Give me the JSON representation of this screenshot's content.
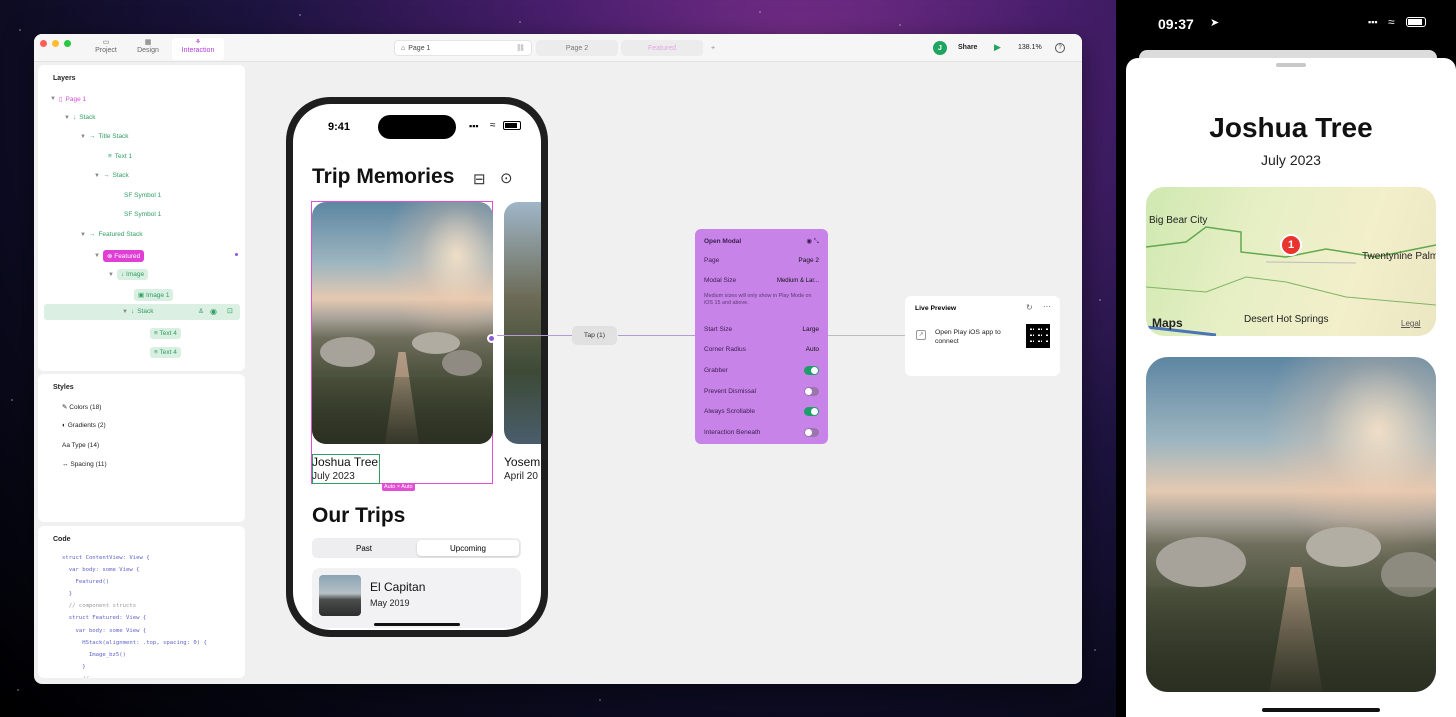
{
  "app": {
    "tabs": [
      {
        "label": "Project",
        "icon": "folder-icon"
      },
      {
        "label": "Design",
        "icon": "grid-icon"
      },
      {
        "label": "Interaction",
        "icon": "interaction-icon"
      }
    ],
    "page_tabs": [
      "Page 1",
      "Page 2",
      "Featured"
    ],
    "share_label": "Share",
    "avatar_initial": "J",
    "zoom": "138.1%",
    "accent": "#b23ed9"
  },
  "layers": {
    "title": "Layers",
    "items": [
      "Page 1",
      "Stack",
      "Title Stack",
      "Text 1",
      "Stack",
      "SF Symbol 1",
      "SF Symbol 1",
      "Featured Stack",
      "Featured",
      "Image",
      "Image 1",
      "Stack",
      "Text 4",
      "Text 4"
    ]
  },
  "styles": {
    "title": "Styles",
    "items": [
      "Colors (18)",
      "Gradients (2)",
      "Type (14)",
      "Spacing (11)"
    ]
  },
  "code": {
    "title": "Code",
    "lines": [
      "struct ContentView: View {",
      "  var body: some View {",
      "    Featured()",
      "  }",
      "  // component structs",
      "  struct Featured: View {",
      "    var body: some View {",
      "      HStack(alignment: .top, spacing: 0) {",
      "        Image_bz5()",
      "      }",
      "      // ..."
    ]
  },
  "phone": {
    "time": "9:41",
    "title": "Trip Memories",
    "card1_title": "Joshua Tree",
    "card1_date": "July 2023",
    "card2_title": "Yosem",
    "card2_date": "April 20",
    "size_badge": "Auto × Auto",
    "section_title": "Our Trips",
    "segments": [
      "Past",
      "Upcoming"
    ],
    "trip_title": "El Capitan",
    "trip_date": "May 2019"
  },
  "flow": {
    "tap_label": "Tap (1)",
    "modal": {
      "title": "Open Modal",
      "page_label": "Page",
      "page_value": "Page 2",
      "size_label": "Modal Size",
      "size_value": "Medium & Lar...",
      "note": "Medium sizes will only show in Play Mode on iOS 15 and above.",
      "start_label": "Start Size",
      "start_value": "Large",
      "radius_label": "Corner Radius",
      "radius_value": "Auto",
      "toggles": [
        {
          "label": "Grabber",
          "on": true
        },
        {
          "label": "Prevent Dismissal",
          "on": false
        },
        {
          "label": "Always Scrollable",
          "on": true
        },
        {
          "label": "Interaction Beneath",
          "on": false
        }
      ]
    },
    "preview": {
      "title": "Live Preview",
      "text": "Open Play iOS app to connect"
    }
  },
  "device": {
    "time": "09:37",
    "title": "Joshua Tree",
    "date": "July 2023",
    "map_labels": [
      "Big Bear City",
      "Twentynine Palm",
      "Desert Hot Springs",
      "Maps",
      "Legal"
    ],
    "pin_number": "1"
  }
}
